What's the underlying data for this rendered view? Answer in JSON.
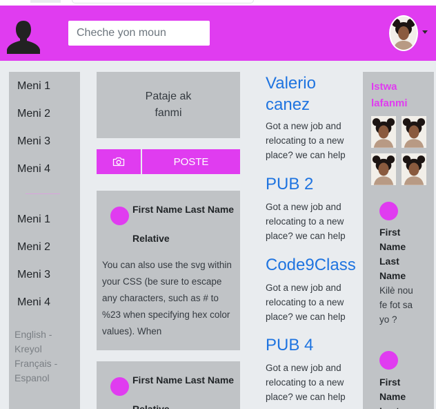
{
  "search": {
    "placeholder": "Cheche yon moun"
  },
  "left_menu": {
    "items_top": [
      "Meni 1",
      "Meni 2",
      "Meni 3",
      "Meni 4"
    ],
    "items_bottom": [
      "Meni 1",
      "Meni 2",
      "Meni 3",
      "Meni 4"
    ],
    "languages": [
      "English -",
      "Kreyol",
      "Français -",
      "Espanol"
    ]
  },
  "share": {
    "prompt": "Pataje ak fanmi",
    "post_label": "POSTE",
    "camera_icon": "camera-icon"
  },
  "posts": [
    {
      "name": "First Name Last Name",
      "relation": "Relative",
      "text": "You can also use the svg within your CSS (be sure to escape any characters, such as # to %23 when specifying hex color values). When"
    },
    {
      "name": "First Name Last Name",
      "relation": "Relative"
    }
  ],
  "ads": [
    {
      "title": "Valerio canez",
      "text": "Got a new job and relocating to a new place? we can help"
    },
    {
      "title": "PUB 2",
      "text": "Got a new job and relocating to a new place? we can help"
    },
    {
      "title": "Code9Class",
      "text": "Got a new job and relocating to a new place? we can help"
    },
    {
      "title": "PUB 4",
      "text": "Got a new job and relocating to a new place? we can help"
    }
  ],
  "right": {
    "title": "Istwa lafanmi",
    "stories": [
      {
        "name": "First Name Last Name",
        "message": "Kilè nou fe fot sa yo ?"
      },
      {
        "name": "First Name Last"
      }
    ]
  },
  "colors": {
    "brand": "#e03cf0",
    "panel": "#c0c3c6",
    "link": "#1f74e0"
  }
}
